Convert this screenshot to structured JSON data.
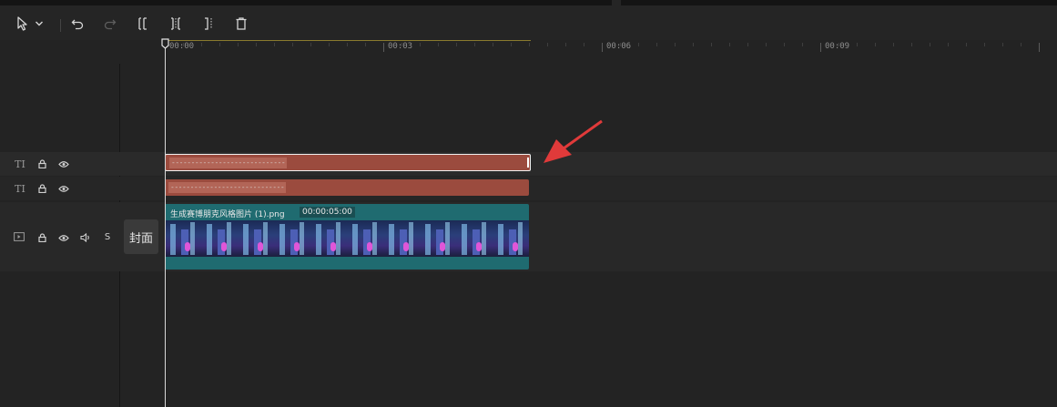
{
  "toolbar": {
    "tools": [
      {
        "name": "select-tool",
        "icon": "cursor-icon"
      },
      {
        "name": "select-dropdown",
        "icon": "chevron-down-icon"
      },
      {
        "name": "undo",
        "icon": "undo-icon"
      },
      {
        "name": "redo",
        "icon": "redo-icon"
      },
      {
        "name": "split-left",
        "icon": "split-left-icon"
      },
      {
        "name": "split",
        "icon": "split-icon"
      },
      {
        "name": "split-right",
        "icon": "split-right-icon"
      },
      {
        "name": "delete",
        "icon": "trash-icon"
      }
    ]
  },
  "ruler": {
    "labels": [
      "00:00",
      "00:03",
      "00:06",
      "00:09"
    ]
  },
  "tracks": {
    "text1": {
      "type_icon": "text-track-icon",
      "type_label": "TI",
      "clip_label": "-----------------------------"
    },
    "text2": {
      "type_icon": "text-track-icon",
      "type_label": "TI",
      "clip_label": "-----------------------------"
    },
    "video": {
      "audio_label": "S",
      "cover_label": "封面",
      "clip_name": "生成赛博朋克风格图片 (1).png",
      "clip_duration": "00:00:05:00"
    }
  },
  "colors": {
    "background": "#232323",
    "text_clip": "#9b4b3e",
    "video_clip": "#1f6b70",
    "arrow": "#e03a3a",
    "playhead": "#d8d8d8"
  }
}
